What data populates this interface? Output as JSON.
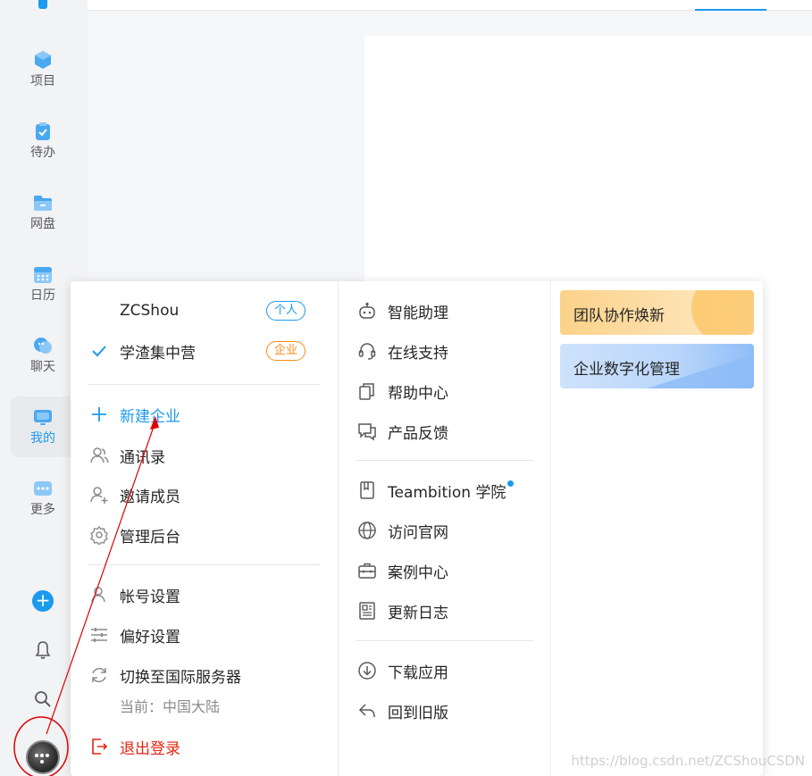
{
  "rail": {
    "items": [
      {
        "label": "项目",
        "icon": "cube-icon"
      },
      {
        "label": "待办",
        "icon": "clipboard-check-icon"
      },
      {
        "label": "网盘",
        "icon": "folder-icon"
      },
      {
        "label": "日历",
        "icon": "calendar-icon"
      },
      {
        "label": "聊天",
        "icon": "chat-icon"
      },
      {
        "label": "我的",
        "icon": "monitor-icon",
        "active": true
      },
      {
        "label": "更多",
        "icon": "more-icon"
      }
    ],
    "plus": "+"
  },
  "menu": {
    "accounts": [
      {
        "name": "ZCShou",
        "tag": "个人",
        "tag_color": "#1b9aee"
      },
      {
        "name": "学渣集中营",
        "tag": "企业",
        "tag_color": "#fa8c16",
        "selected": true
      }
    ],
    "org_actions": {
      "new_org": "新建企业",
      "contacts": "通讯录",
      "invite": "邀请成员",
      "admin": "管理后台"
    },
    "account_actions": {
      "account_settings": "帐号设置",
      "preferences": "偏好设置",
      "switch_server": "切换至国际服务器",
      "current_server": "当前：中国大陆",
      "logout": "退出登录"
    },
    "help": {
      "assistant": "智能助理",
      "online_support": "在线支持",
      "help_center": "帮助中心",
      "feedback": "产品反馈"
    },
    "resources": {
      "academy": "Teambition 学院",
      "website": "访问官网",
      "cases": "案例中心",
      "changelog": "更新日志"
    },
    "other": {
      "download": "下载应用",
      "old_version": "回到旧版"
    },
    "promos": {
      "team": "团队协作焕新",
      "digital": "企业数字化管理"
    }
  },
  "colors": {
    "accent": "#1b9aee",
    "danger": "#e62412",
    "annotation": "#e00000"
  },
  "watermark": "https://blog.csdn.net/ZCShouCSDN"
}
